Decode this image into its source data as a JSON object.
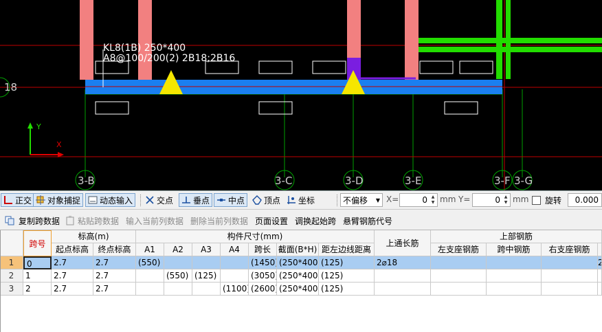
{
  "canvas": {
    "beam_label_line1": "KL8(1B) 250*400",
    "beam_label_line2": "A8@100/200(2) 2B18;2B16",
    "row_axis_label": "18",
    "ucs_y_label": "Y",
    "ucs_x_label": "X",
    "axis_labels": [
      "3-B",
      "3-C",
      "3-D",
      "3-E",
      "3-F",
      "3-G"
    ],
    "colors": {
      "column": "#f28080",
      "beam": "#1a7ff0",
      "green_beam": "#22dd00",
      "support": "#f5e600",
      "highlight": "#7a1ee0",
      "grid": "#00a000",
      "red_line": "#c00000"
    }
  },
  "snapbar": {
    "ortho": "正交",
    "object_snap": "对象捕捉",
    "dynamic_input": "动态输入",
    "intersection": "交点",
    "perpendicular": "垂点",
    "midpoint": "中点",
    "vertex": "顶点",
    "coordinate": "坐标",
    "offset_select": "不偏移",
    "x_label": "X=",
    "x_value": "0",
    "x_unit": "mm",
    "y_label": "Y=",
    "y_value": "0",
    "y_unit": "mm",
    "rotate_label": "旋转",
    "rotate_value": "0.000"
  },
  "toolbar2": {
    "copy_span": "复制跨数据",
    "paste_span": "粘贴跨数据",
    "input_col": "输入当前列数据",
    "delete_col": "删除当前列数据",
    "page_setup": "页面设置",
    "adjust_start": "调换起始跨",
    "cantilever": "悬臂钢筋代号"
  },
  "table": {
    "header": {
      "span_no": "跨号",
      "elevation_group": "标高(m)",
      "start_elev": "起点标高",
      "end_elev": "终点标高",
      "dims_group": "构件尺寸(mm)",
      "a1": "A1",
      "a2": "A2",
      "a3": "A3",
      "a4": "A4",
      "span_len": "跨长",
      "section": "截面(B*H)",
      "edge_dist": "距左边线距离",
      "top_through": "上通长筋",
      "top_rebar_group": "上部钢筋",
      "left_support": "左支座钢筋",
      "mid_span": "跨中钢筋",
      "right_support": "右支座钢筋"
    },
    "rows": [
      {
        "idx": "1",
        "span": "0",
        "start": "2.7",
        "end": "2.7",
        "a1": "(550)",
        "a2": "",
        "a3": "",
        "a4": "",
        "len": "(1450)",
        "sec": "(250*400)",
        "dist": "(125)",
        "top": "2⌀18",
        "left": "",
        "mid": "",
        "right": "",
        "extra": "2"
      },
      {
        "idx": "2",
        "span": "1",
        "start": "2.7",
        "end": "2.7",
        "a1": "",
        "a2": "(550)",
        "a3": "(125)",
        "a4": "",
        "len": "(3050)",
        "sec": "(250*400)",
        "dist": "(125)",
        "top": "",
        "left": "",
        "mid": "",
        "right": "",
        "extra": ""
      },
      {
        "idx": "3",
        "span": "2",
        "start": "2.7",
        "end": "2.7",
        "a1": "",
        "a2": "",
        "a3": "",
        "a4": "(1100)",
        "len": "(2600)",
        "sec": "(250*400)",
        "dist": "(125)",
        "top": "",
        "left": "",
        "mid": "",
        "right": "",
        "extra": ""
      }
    ]
  }
}
